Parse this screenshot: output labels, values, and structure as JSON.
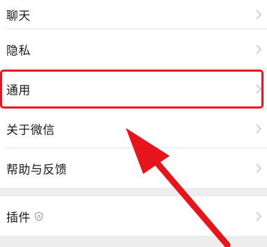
{
  "settings": {
    "items": [
      {
        "label": "聊天"
      },
      {
        "label": "隐私"
      },
      {
        "label": "通用"
      },
      {
        "label": "关于微信"
      },
      {
        "label": "帮助与反馈"
      },
      {
        "label": "插件"
      }
    ]
  },
  "icons": {
    "chevron": "chevron-right-icon",
    "plugin_badge": "shield-icon"
  },
  "colors": {
    "highlight": "#e8141b",
    "background": "#ededed",
    "row": "#ffffff",
    "text": "#1a1a1a",
    "chevron": "#c8c8c8"
  }
}
